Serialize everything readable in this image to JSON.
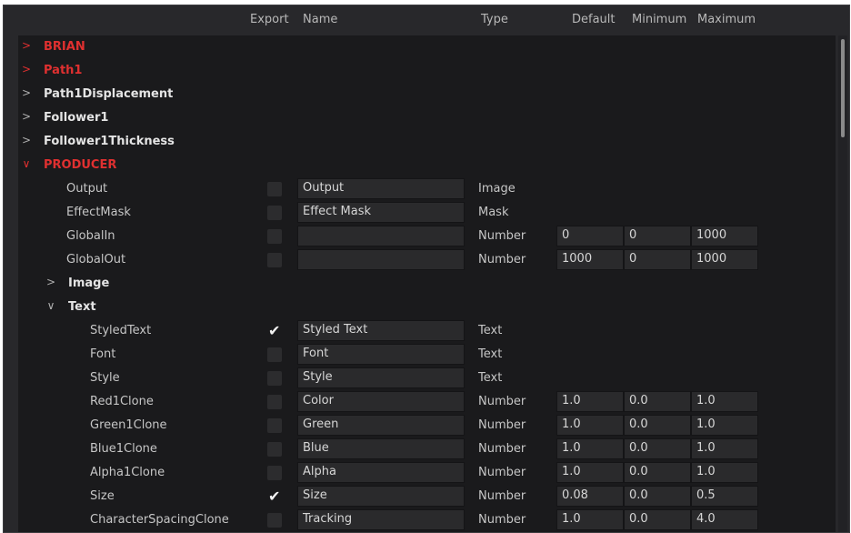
{
  "header": {
    "export": "Export",
    "name": "Name",
    "type": "Type",
    "default": "Default",
    "minimum": "Minimum",
    "maximum": "Maximum"
  },
  "groups": [
    {
      "label": "BRIAN",
      "expanded": false,
      "color": "#e03030"
    },
    {
      "label": "Path1",
      "expanded": false,
      "color": "#e03030"
    },
    {
      "label": "Path1Displacement",
      "expanded": false
    },
    {
      "label": "Follower1",
      "expanded": false
    },
    {
      "label": "Follower1Thickness",
      "expanded": false
    },
    {
      "label": "PRODUCER",
      "expanded": true,
      "color": "#e03030"
    }
  ],
  "producer_params": [
    {
      "label": "Output",
      "checked": false,
      "name": "Output",
      "type": "Image"
    },
    {
      "label": "EffectMask",
      "checked": false,
      "name": "Effect Mask",
      "type": "Mask"
    },
    {
      "label": "GlobalIn",
      "checked": false,
      "name": "",
      "type": "Number",
      "default": "0",
      "min": "0",
      "max": "1000"
    },
    {
      "label": "GlobalOut",
      "checked": false,
      "name": "",
      "type": "Number",
      "default": "1000",
      "min": "0",
      "max": "1000"
    }
  ],
  "subgroups": [
    {
      "label": "Image",
      "expanded": false
    },
    {
      "label": "Text",
      "expanded": true
    }
  ],
  "text_params": [
    {
      "label": "StyledText",
      "checked": true,
      "name": "Styled Text",
      "type": "Text"
    },
    {
      "label": "Font",
      "checked": false,
      "name": "Font",
      "type": "Text"
    },
    {
      "label": "Style",
      "checked": false,
      "name": "Style",
      "type": "Text"
    },
    {
      "label": "Red1Clone",
      "checked": false,
      "name": "Color",
      "type": "Number",
      "default": "1.0",
      "min": "0.0",
      "max": "1.0"
    },
    {
      "label": "Green1Clone",
      "checked": false,
      "name": "Green",
      "type": "Number",
      "default": "1.0",
      "min": "0.0",
      "max": "1.0"
    },
    {
      "label": "Blue1Clone",
      "checked": false,
      "name": "Blue",
      "type": "Number",
      "default": "1.0",
      "min": "0.0",
      "max": "1.0"
    },
    {
      "label": "Alpha1Clone",
      "checked": false,
      "name": "Alpha",
      "type": "Number",
      "default": "1.0",
      "min": "0.0",
      "max": "1.0"
    },
    {
      "label": "Size",
      "checked": true,
      "name": "Size",
      "type": "Number",
      "default": "0.08",
      "min": "0.0",
      "max": "0.5"
    },
    {
      "label": "CharacterSpacingClone",
      "checked": false,
      "name": "Tracking",
      "type": "Number",
      "default": "1.0",
      "min": "0.0",
      "max": "4.0"
    }
  ],
  "icons": {
    "collapsed": "chevron-right-icon",
    "expanded": "chevron-down-icon",
    "check": "checkmark-icon"
  }
}
